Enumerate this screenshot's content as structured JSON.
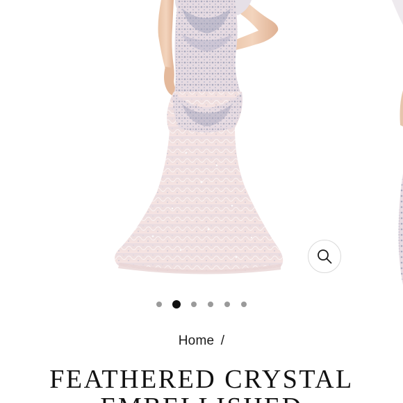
{
  "gallery": {
    "zoom_icon": "magnifier-icon",
    "slide_count": 6,
    "active_slide": 2,
    "dress_color": "#f1dede",
    "bead_color": "#a9a9bd"
  },
  "breadcrumb": {
    "home_label": "Home",
    "separator": "/"
  },
  "product": {
    "title_line1": "FEATHERED CRYSTAL",
    "title_line2": "EMBELLISHED"
  }
}
